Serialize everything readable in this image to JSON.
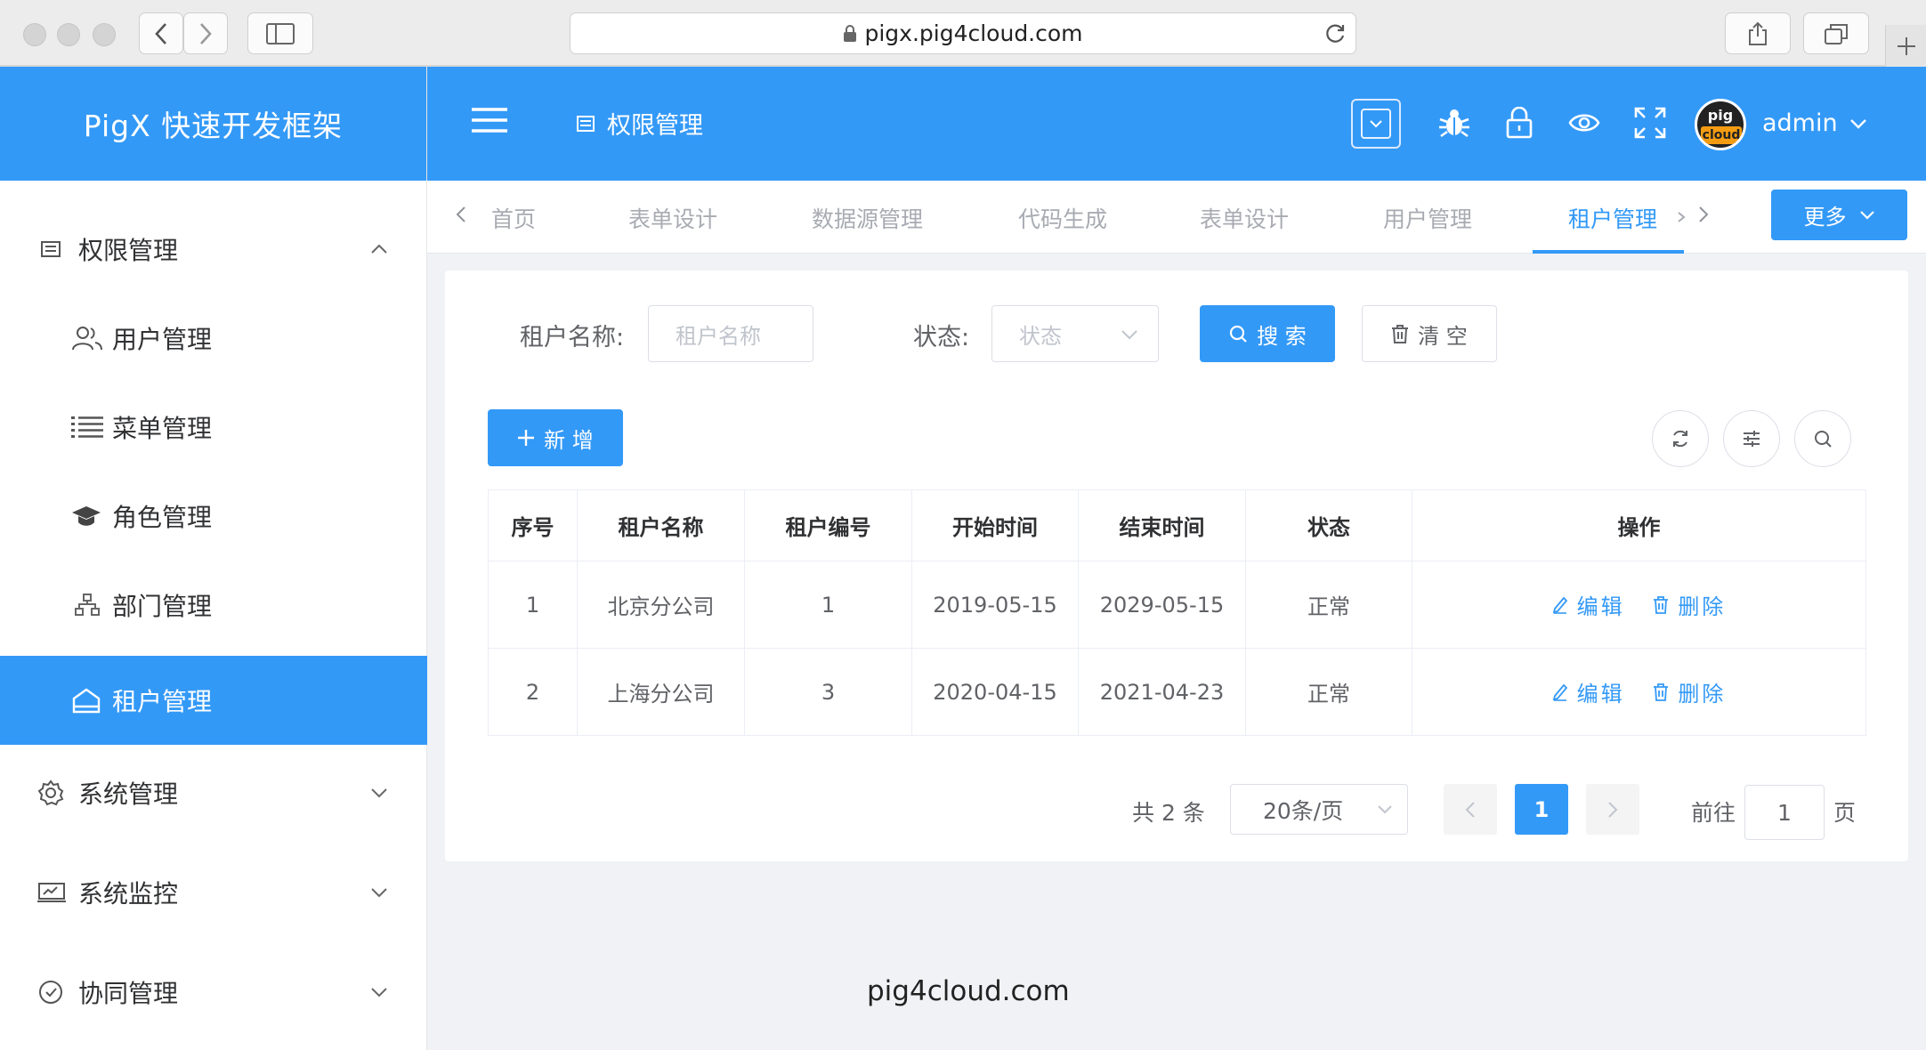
{
  "browser": {
    "url": "pigx.pig4cloud.com"
  },
  "app": {
    "logo": "PigX 快速开发框架"
  },
  "sidebar": {
    "items": [
      {
        "label": "权限管理"
      },
      {
        "label": "用户管理"
      },
      {
        "label": "菜单管理"
      },
      {
        "label": "角色管理"
      },
      {
        "label": "部门管理"
      },
      {
        "label": "租户管理"
      },
      {
        "label": "系统管理"
      },
      {
        "label": "系统监控"
      },
      {
        "label": "协同管理"
      }
    ]
  },
  "header": {
    "breadcrumb": "权限管理",
    "avatar_top": "pig",
    "avatar_bottom": "cloud",
    "user": "admin"
  },
  "tabs": {
    "items": [
      "首页",
      "表单设计",
      "数据源管理",
      "代码生成",
      "表单设计",
      "用户管理",
      "租户管理"
    ],
    "active": "租户管理",
    "more": "更多"
  },
  "filter": {
    "name_label": "租户名称:",
    "name_placeholder": "租户名称",
    "status_label": "状态:",
    "status_placeholder": "状态",
    "search": "搜 索",
    "clear": "清 空"
  },
  "toolbar": {
    "add": "新 增"
  },
  "table": {
    "headers": [
      "序号",
      "租户名称",
      "租户编号",
      "开始时间",
      "结束时间",
      "状态",
      "操作"
    ],
    "rows": [
      {
        "no": "1",
        "name": "北京分公司",
        "code": "1",
        "start": "2019-05-15",
        "end": "2029-05-15",
        "status": "正常"
      },
      {
        "no": "2",
        "name": "上海分公司",
        "code": "3",
        "start": "2020-04-15",
        "end": "2021-04-23",
        "status": "正常"
      }
    ],
    "edit": "编辑",
    "delete": "删除"
  },
  "pagination": {
    "total": "共 2 条",
    "page_size": "20条/页",
    "current": "1",
    "goto": "前往",
    "goto_value": "1",
    "page_suffix": "页"
  },
  "footer": "pig4cloud.com",
  "colors": {
    "primary": "#3399f7",
    "sidebar_bg": "#ffffff",
    "content_bg": "#f0f2f5"
  }
}
